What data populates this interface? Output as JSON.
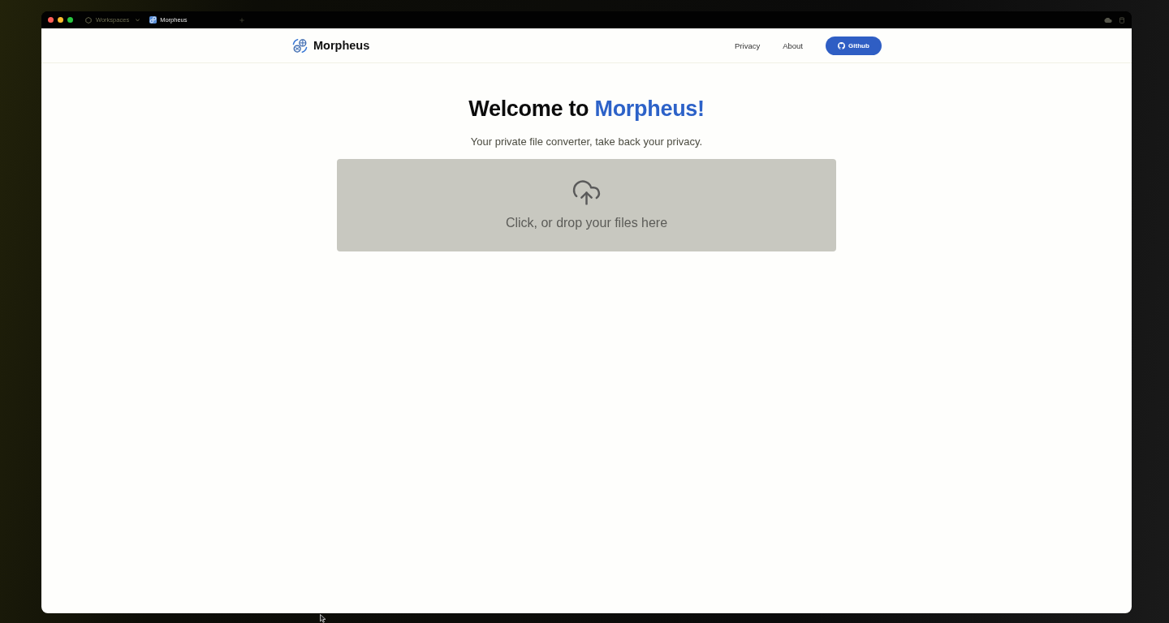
{
  "titlebar": {
    "buttons": [
      {
        "color": "#ff5f57"
      },
      {
        "color": "#febc2e"
      },
      {
        "color": "#28c840"
      }
    ],
    "workspace": "Workspaces",
    "tabs": [
      {
        "label": "Morpheus",
        "selected": true
      }
    ]
  },
  "navbar": {
    "brand": "Morpheus",
    "links": [
      {
        "label": "Privacy"
      },
      {
        "label": "About"
      }
    ],
    "github_button": "Github"
  },
  "hero": {
    "title": "Welcome to",
    "title_highlight": "Morpheus!",
    "subtitle": "Your private file converter, take back your privacy."
  },
  "dropzone": {
    "label": "Click, or drop your files here"
  }
}
